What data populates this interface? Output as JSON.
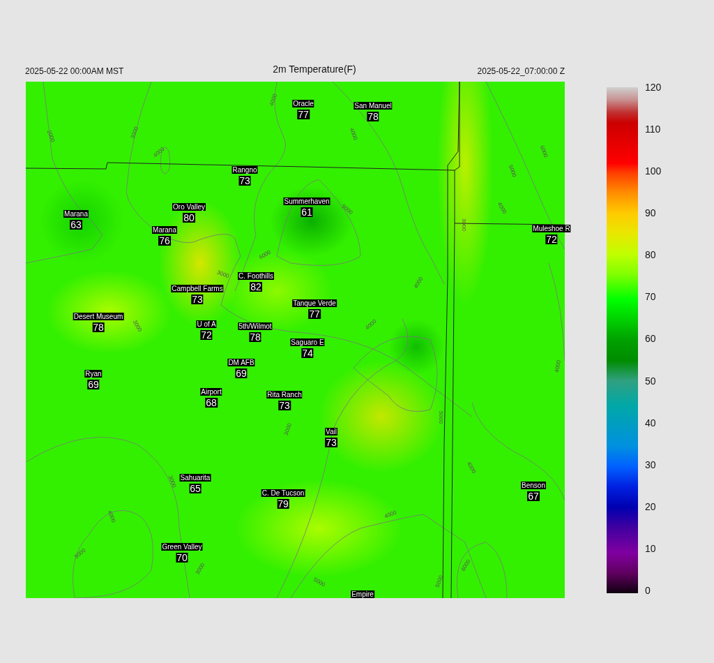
{
  "header": {
    "valid_time": "2025-05-22 00:00AM MST",
    "title": "2m Temperature(F)",
    "model_time": "2025-05-22_07:00:00 Z"
  },
  "stations": [
    {
      "name": "Oracle",
      "value": "77"
    },
    {
      "name": "San Manuel",
      "value": "78"
    },
    {
      "name": "Rangno",
      "value": "73"
    },
    {
      "name": "Summerhaven",
      "value": "61"
    },
    {
      "name": "Oro Valley",
      "value": "80"
    },
    {
      "name": "Marana",
      "value": "63"
    },
    {
      "name": "Marana",
      "value": "76"
    },
    {
      "name": "Muleshoe R",
      "value": "72"
    },
    {
      "name": "C. Foothills",
      "value": "82"
    },
    {
      "name": "Campbell Farms",
      "value": "73"
    },
    {
      "name": "Tanque Verde",
      "value": "77"
    },
    {
      "name": "Desert Museum",
      "value": "78"
    },
    {
      "name": "U of A",
      "value": "72"
    },
    {
      "name": "5th/Wilmot",
      "value": "78"
    },
    {
      "name": "Saguaro E",
      "value": "74"
    },
    {
      "name": "DM AFB",
      "value": "69"
    },
    {
      "name": "Ryan",
      "value": "69"
    },
    {
      "name": "Airport",
      "value": "68"
    },
    {
      "name": "Rita Ranch",
      "value": "73"
    },
    {
      "name": "Vail",
      "value": "73"
    },
    {
      "name": "Sahuarita",
      "value": "65"
    },
    {
      "name": "C. De Tucson",
      "value": "79"
    },
    {
      "name": "Benson",
      "value": "67"
    },
    {
      "name": "Green Valley",
      "value": "70"
    },
    {
      "name": "Empire"
    }
  ],
  "contour_labels": [
    "2000",
    "3000",
    "4000",
    "4000",
    "4000",
    "5000",
    "6000",
    "3000",
    "3000",
    "4000",
    "4000",
    "5000",
    "6000",
    "3000",
    "4000",
    "4000",
    "4000",
    "5000",
    "3000",
    "3000",
    "5000",
    "4000",
    "4000",
    "3000",
    "5000",
    "6000",
    "5000"
  ],
  "color_scale": {
    "ticks": [
      "120",
      "110",
      "100",
      "90",
      "80",
      "70",
      "60",
      "50",
      "40",
      "30",
      "20",
      "10",
      "0"
    ]
  }
}
